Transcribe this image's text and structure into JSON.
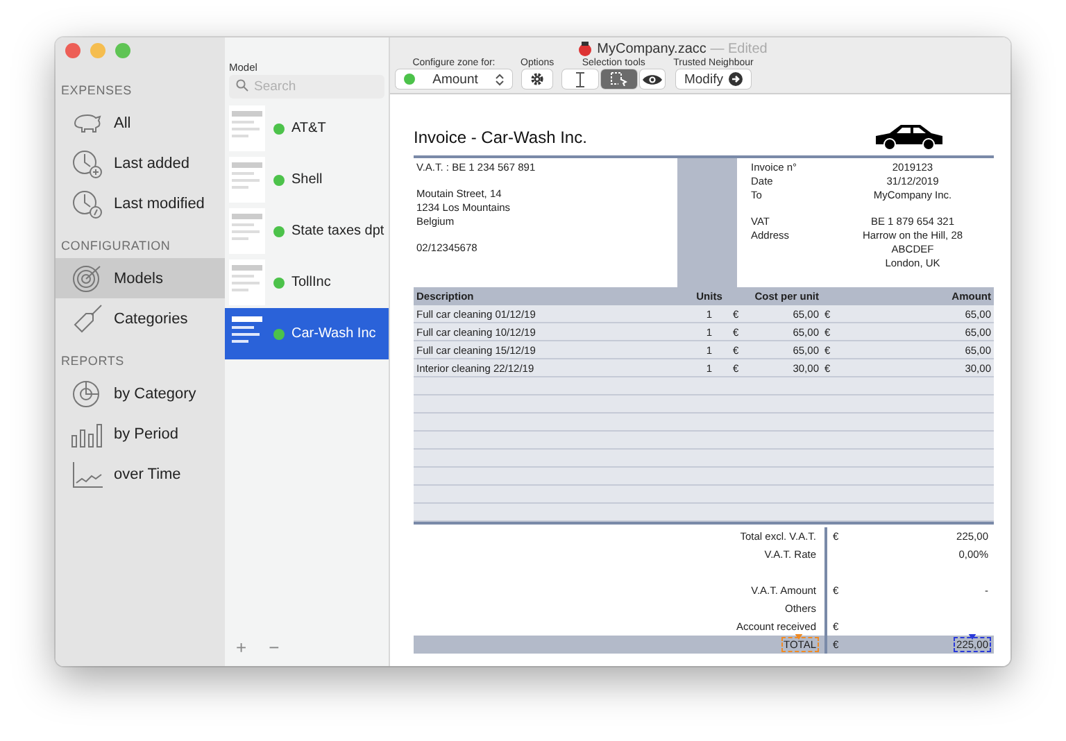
{
  "window": {
    "title": "MyCompany.zacc",
    "status": "— Edited"
  },
  "sidebar": [
    {
      "heading": "EXPENSES",
      "items": [
        {
          "label": "All",
          "selected": false
        },
        {
          "label": "Last added",
          "selected": false
        },
        {
          "label": "Last modified",
          "selected": false
        }
      ]
    },
    {
      "heading": "CONFIGURATION",
      "items": [
        {
          "label": "Models",
          "selected": true
        },
        {
          "label": "Categories",
          "selected": false
        }
      ]
    },
    {
      "heading": "REPORTS",
      "items": [
        {
          "label": "by Category",
          "selected": false
        },
        {
          "label": "by Period",
          "selected": false
        },
        {
          "label": "over Time",
          "selected": false
        }
      ]
    }
  ],
  "models": {
    "heading": "Model",
    "search": {
      "placeholder": "Search"
    },
    "items": [
      {
        "name": "AT&T",
        "selected": false
      },
      {
        "name": "Shell",
        "selected": false
      },
      {
        "name": "State taxes dpt",
        "selected": false
      },
      {
        "name": "TollInc",
        "selected": false
      },
      {
        "name": "Car-Wash Inc",
        "selected": true
      }
    ],
    "footer": [
      "+",
      "−"
    ]
  },
  "toolbar": {
    "configure": {
      "label": "Configure zone for:",
      "value": "Amount"
    },
    "options": {
      "label": "Options"
    },
    "selection_tools": {
      "label": "Selection tools",
      "tools": [
        {
          "selected": false
        },
        {
          "selected": true
        },
        {
          "selected": false
        }
      ]
    },
    "trusted": {
      "label": "Trusted Neighbour",
      "button": "Modify"
    }
  },
  "invoice": {
    "title": "Invoice - Car-Wash Inc.",
    "sender": [
      [
        "V.A.T. : BE 1 234 567 891"
      ],
      [
        "Moutain Street, 14",
        "1234 Los Mountains",
        "Belgium"
      ],
      [
        "02/12345678"
      ]
    ],
    "details": [
      [
        {
          "label": "Invoice n°",
          "values": [
            "2019123"
          ]
        },
        {
          "label": "Date",
          "values": [
            "31/12/2019"
          ]
        },
        {
          "label": "To",
          "values": [
            "MyCompany Inc."
          ]
        }
      ],
      [
        {
          "label": "VAT",
          "values": [
            "BE 1 879 654 321"
          ]
        },
        {
          "label": "Address",
          "values": [
            "Harrow on the Hill, 28",
            "ABCDEF",
            "London, UK"
          ]
        }
      ]
    ],
    "columns": [
      "Description",
      "Units",
      "Cost per unit",
      "Amount"
    ],
    "rows": [
      {
        "description": "Full car cleaning 01/12/19",
        "units": "1",
        "cost_currency": "€",
        "cost": "65,00",
        "amount_currency": "€",
        "amount": "65,00"
      },
      {
        "description": "Full car cleaning 10/12/19",
        "units": "1",
        "cost_currency": "€",
        "cost": "65,00",
        "amount_currency": "€",
        "amount": "65,00"
      },
      {
        "description": "Full car cleaning 15/12/19",
        "units": "1",
        "cost_currency": "€",
        "cost": "65,00",
        "amount_currency": "€",
        "amount": "65,00"
      },
      {
        "description": "Interior cleaning 22/12/19",
        "units": "1",
        "cost_currency": "€",
        "cost": "30,00",
        "amount_currency": "€",
        "amount": "30,00"
      }
    ],
    "totals": [
      {
        "kind": "line",
        "label": "Total excl. V.A.T.",
        "currency": "€",
        "value": "225,00"
      },
      {
        "kind": "line",
        "label": "V.A.T. Rate",
        "value": "0,00%"
      },
      {
        "kind": "gap"
      },
      {
        "kind": "line",
        "label": "V.A.T. Amount",
        "currency": "€",
        "value": "-"
      },
      {
        "kind": "line",
        "label": "Others"
      },
      {
        "kind": "line",
        "label": "Account received",
        "currency": "€"
      },
      {
        "kind": "total",
        "label": "TOTAL",
        "currency": "€",
        "value": "225,00",
        "label_selected": true,
        "value_selected": true
      }
    ]
  }
}
